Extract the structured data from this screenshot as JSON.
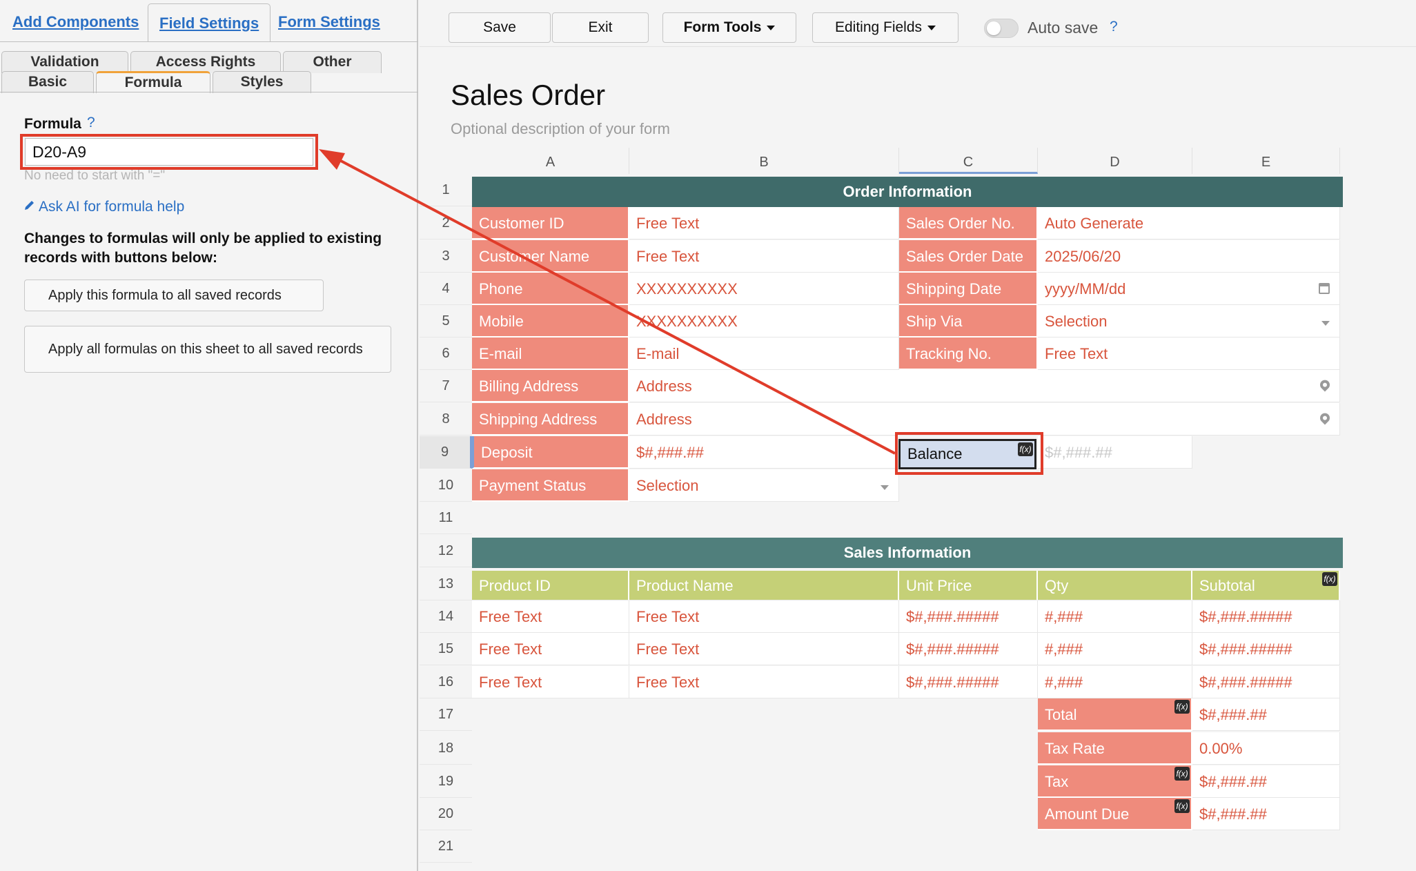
{
  "left_tabs": [
    "Add Components",
    "Field Settings",
    "Form Settings"
  ],
  "sub_tabs_row1": [
    "Validation",
    "Access Rights",
    "Other"
  ],
  "sub_tabs_row2": [
    "Basic",
    "Formula",
    "Styles"
  ],
  "formula": {
    "label": "Formula",
    "help": "?",
    "value": "D20-A9",
    "hint": "No need to start with \"=\""
  },
  "ai_link": "Ask AI for formula help",
  "changes_text": "Changes to formulas will only be applied to existing records with buttons below:",
  "btn_apply_one": "Apply this formula to all saved records",
  "btn_apply_all": "Apply all formulas on this sheet to all saved records",
  "toolbar": {
    "save": "Save",
    "exit": "Exit",
    "form_tools": "Form Tools",
    "editing_fields": "Editing Fields",
    "autosave": "Auto save",
    "help": "?"
  },
  "form": {
    "title": "Sales Order",
    "description": "Optional description of your form"
  },
  "columns": [
    "A",
    "B",
    "C",
    "D",
    "E"
  ],
  "rows": [
    "1",
    "2",
    "3",
    "4",
    "5",
    "6",
    "7",
    "8",
    "9",
    "10",
    "11",
    "12",
    "13",
    "14",
    "15",
    "16",
    "17",
    "18",
    "19",
    "20",
    "21"
  ],
  "order_header": "Order Information",
  "sales_header": "Sales Information",
  "order_rows": [
    {
      "a": "Customer ID",
      "b": "Free Text",
      "c": "Sales Order No.",
      "d": "Auto Generate"
    },
    {
      "a": "Customer Name",
      "b": "Free Text",
      "c": "Sales Order Date",
      "d": "2025/06/20"
    },
    {
      "a": "Phone",
      "b": "XXXXXXXXXX",
      "c": "Shipping Date",
      "d": "yyyy/MM/dd"
    },
    {
      "a": "Mobile",
      "b": "XXXXXXXXXX",
      "c": "Ship Via",
      "d": "Selection"
    },
    {
      "a": "E-mail",
      "b": "E-mail",
      "c": "Tracking No.",
      "d": "Free Text"
    }
  ],
  "billing": {
    "label": "Billing Address",
    "value": "Address"
  },
  "shipping": {
    "label": "Shipping Address",
    "value": "Address"
  },
  "deposit": {
    "label": "Deposit",
    "value": "$#,###.##"
  },
  "balance": {
    "label": "Balance",
    "value": "$#,###.##"
  },
  "payment": {
    "label": "Payment Status",
    "value": "Selection"
  },
  "product_headers": [
    "Product ID",
    "Product Name",
    "Unit Price",
    "Qty",
    "Subtotal"
  ],
  "product_rows": [
    [
      "Free Text",
      "Free Text",
      "$#,###.#####",
      "#,###",
      "$#,###.#####"
    ],
    [
      "Free Text",
      "Free Text",
      "$#,###.#####",
      "#,###",
      "$#,###.#####"
    ],
    [
      "Free Text",
      "Free Text",
      "$#,###.#####",
      "#,###",
      "$#,###.#####"
    ]
  ],
  "totals": [
    {
      "label": "Total",
      "value": "$#,###.##"
    },
    {
      "label": "Tax Rate",
      "value": "0.00%"
    },
    {
      "label": "Tax",
      "value": "$#,###.##"
    },
    {
      "label": "Amount Due",
      "value": "$#,###.##"
    }
  ],
  "fx_label": "f(x)",
  "colors": {
    "accent": "#2a6fc4",
    "label_bg": "#ef8b7c",
    "header_bg": "#3f6b6a",
    "product_bg": "#c5d077",
    "highlight": "#e03c2a"
  }
}
